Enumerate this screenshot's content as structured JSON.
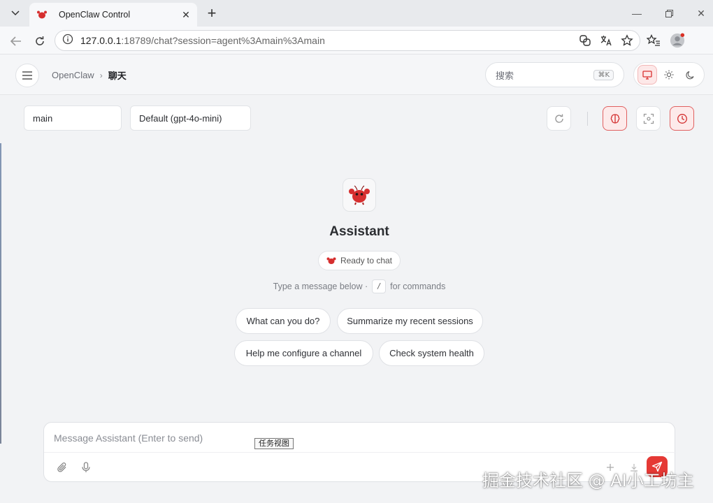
{
  "browser": {
    "tab_title": "OpenClaw Control",
    "url_host": "127.0.0.1",
    "url_rest": ":18789/chat?session=agent%3Amain%3Amain",
    "tooltip": "任务视图"
  },
  "header": {
    "breadcrumb_root": "OpenClaw",
    "breadcrumb_sep": "›",
    "breadcrumb_current": "聊天",
    "search_placeholder": "搜索",
    "search_shortcut": "⌘K"
  },
  "toolbar": {
    "agent_select": "main",
    "model_select": "Default (gpt-4o-mini)"
  },
  "welcome": {
    "assistant_name": "Assistant",
    "status": "Ready to chat",
    "hint_prefix": "Type a message below ·",
    "hint_key": "/",
    "hint_suffix": "for commands"
  },
  "suggestions": [
    "What can you do?",
    "Summarize my recent sessions",
    "Help me configure a channel",
    "Check system health"
  ],
  "composer": {
    "placeholder": "Message Assistant (Enter to send)"
  },
  "watermark": "掘金技术社区 @ AI小工坊主",
  "colors": {
    "accent": "#e53935",
    "accent_soft": "#fdeaea"
  }
}
